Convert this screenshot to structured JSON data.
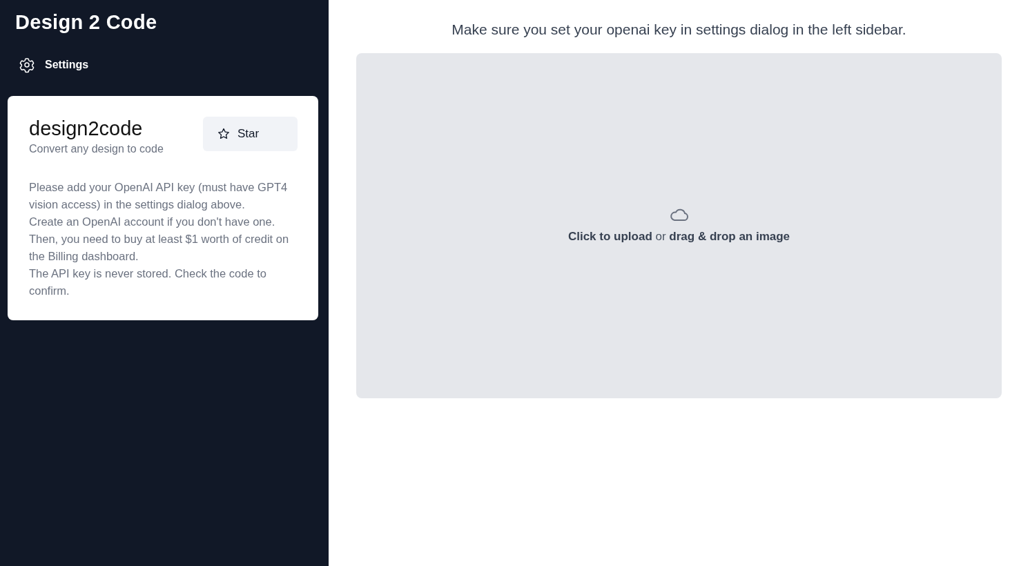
{
  "sidebar": {
    "title": "Design 2 Code",
    "settings_label": "Settings",
    "card": {
      "repo_name": "design2code",
      "tagline": "Convert any design to code",
      "star_label": "Star",
      "paragraphs": [
        "Please add your OpenAI API key (must have GPT4 vision access) in the settings dialog above.",
        "Create an OpenAI account if you don't have one. Then, you need to buy at least $1 worth of credit on the Billing dashboard.",
        "The API key is never stored. Check the code to confirm."
      ]
    }
  },
  "main": {
    "notice": "Make sure you set your openai key in settings dialog in the left sidebar.",
    "dropzone": {
      "text": "**Click to upload** or **drag & drop an image**"
    }
  }
}
